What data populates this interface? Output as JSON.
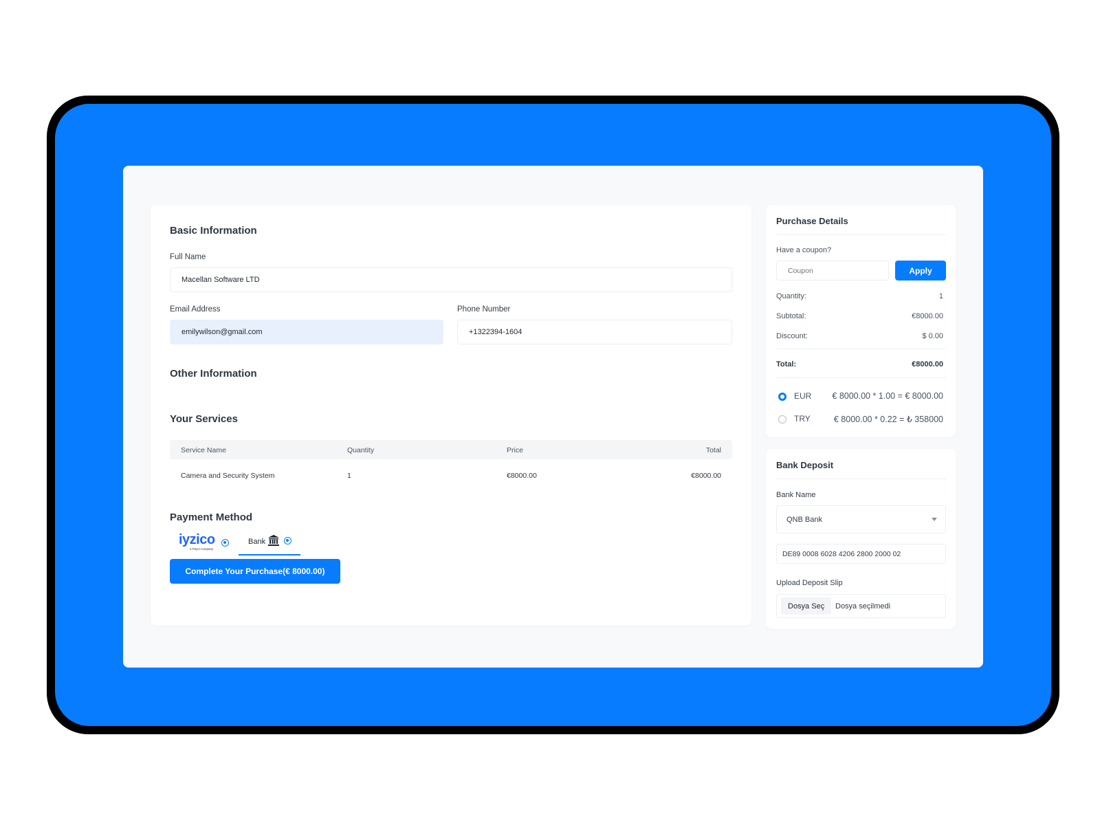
{
  "basic": {
    "title": "Basic Information",
    "full_name_label": "Full Name",
    "full_name_value": "Macellan Software LTD",
    "email_label": "Email Address",
    "email_value": "emilywilson@gmail.com",
    "phone_label": "Phone Number",
    "phone_value": "+1322394-1604"
  },
  "other": {
    "title": "Other Information"
  },
  "services": {
    "title": "Your Services",
    "columns": [
      "Service Name",
      "Quantity",
      "Price",
      "Total"
    ],
    "rows": [
      {
        "name": "Camera and Security System",
        "quantity": "1",
        "price": "€8000.00",
        "total": "€8000.00"
      }
    ]
  },
  "payment": {
    "title": "Payment Method",
    "iyzico_logo": "iyzico",
    "iyzico_tagline": "a PayU company",
    "bank_label": "Bank",
    "submit_label": "Complete Your Purchase(€ 8000.00)"
  },
  "purchase": {
    "title": "Purchase Details",
    "coupon_label": "Have a coupon?",
    "coupon_placeholder": "Coupon",
    "apply_label": "Apply",
    "quantity_label": "Quantity:",
    "quantity_value": "1",
    "subtotal_label": "Subtotal:",
    "subtotal_value": "€8000.00",
    "discount_label": "Discount:",
    "discount_value": "$ 0.00",
    "total_label": "Total:",
    "total_value": "€8000.00",
    "currencies": [
      {
        "code": "EUR",
        "formula": "€ 8000.00 * 1.00 = € 8000.00",
        "selected": true
      },
      {
        "code": "TRY",
        "formula": "€ 8000.00 * 0.22 = ₺ 358000",
        "selected": false
      }
    ]
  },
  "bank": {
    "title": "Bank Deposit",
    "bank_name_label": "Bank Name",
    "bank_selected": "QNB Bank",
    "iban": "DE89 0008 6028 4206 2800 2000 02",
    "upload_label": "Upload Deposit Slip",
    "file_button": "Dosya Seç",
    "file_status": "Dosya seçilmedi"
  },
  "colors": {
    "accent": "#077cff",
    "device_frame": "#000000",
    "page_bg": "#f8f9fb"
  },
  "icons": [
    "bank-building-icon",
    "chevron-down-icon"
  ]
}
